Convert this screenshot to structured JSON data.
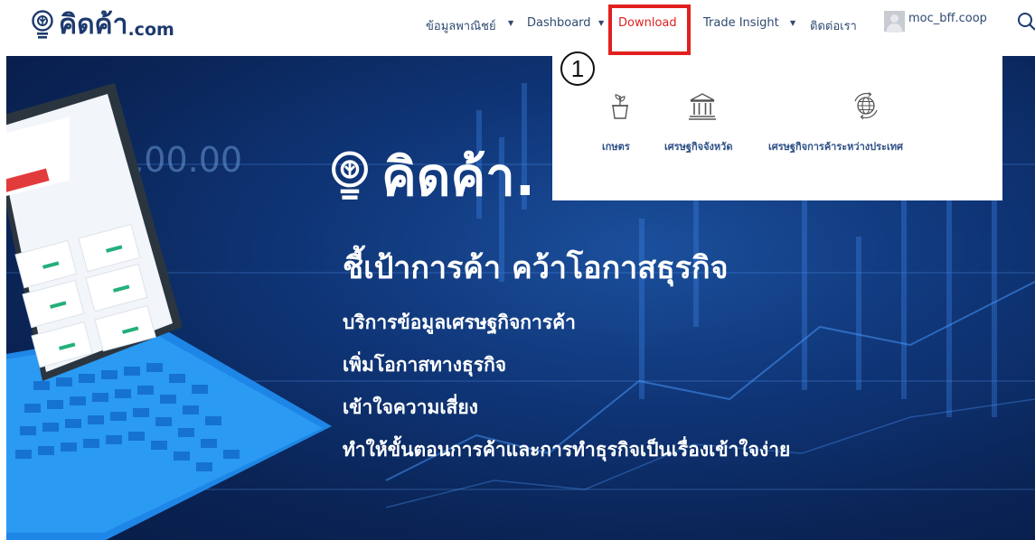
{
  "header": {
    "logo_text": "คิดค้า",
    "logo_suffix": ".com",
    "nav": [
      {
        "label": "ข้อมูลพาณิชย์",
        "has_caret": true
      },
      {
        "label": "Dashboard",
        "has_caret": true
      },
      {
        "label": "Download",
        "has_caret": false,
        "active": true
      },
      {
        "label": "Trade Insight",
        "has_caret": true
      },
      {
        "label": "ติดต่อเรา",
        "has_caret": false
      }
    ],
    "username": "moc_bff.coop",
    "caret_glyph": "▼"
  },
  "dropdown": {
    "step_badge": "1",
    "items": [
      {
        "label": "เกษตร",
        "icon": "plant-pot-icon"
      },
      {
        "label": "เศรษฐกิจจังหวัด",
        "icon": "government-building-icon"
      },
      {
        "label": "เศรษฐกิจการค้าระหว่างประเทศ",
        "icon": "globe-exchange-icon"
      }
    ]
  },
  "hero": {
    "logo_text": "คิดค้า.",
    "headline": "ชี้เป้าการค้า คว้าโอกาสธุรกิจ",
    "lines": [
      "บริการข้อมูลเศรษฐกิจการค้า",
      "เพิ่มโอกาสทางธุรกิจ",
      "เข้าใจความเสี่ยง",
      "ทำให้ขั้นตอนการค้าและการทำธุรกิจเป็นเรื่องเข้าใจง่าย"
    ],
    "background_number": "+11,00.00"
  },
  "colors": {
    "brand_navy": "#1d3a6e",
    "nav_text": "#2f4a72",
    "active_nav": "#e02020",
    "highlight": "#e21f1f",
    "hero_bg": "#0f3577"
  }
}
